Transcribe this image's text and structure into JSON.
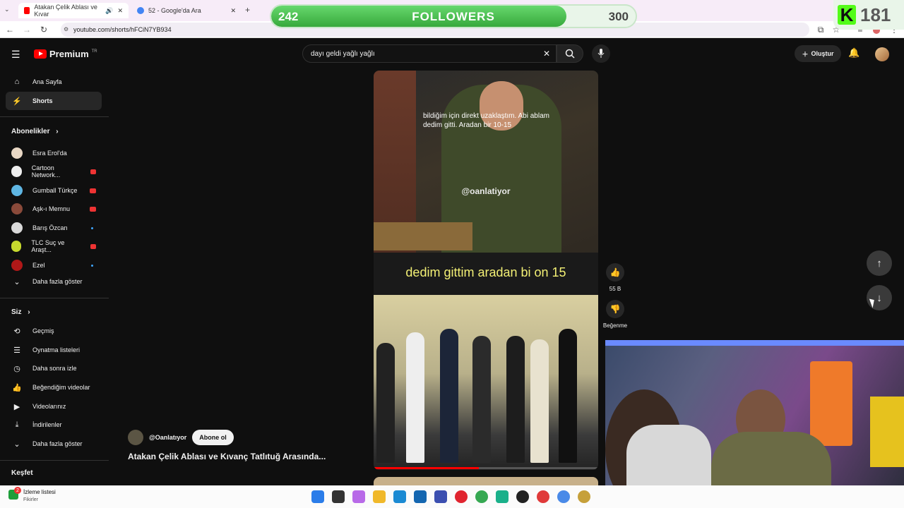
{
  "browser": {
    "tabs": [
      {
        "title": "Atakan Çelik Ablası ve Kıvar",
        "active": true
      },
      {
        "title": "52 - Google'da Ara",
        "active": false
      }
    ],
    "new_tab": "+",
    "url": "youtube.com/shorts/hFCiN7YB934"
  },
  "overlay": {
    "followers_current": "242",
    "followers_label": "FOLLOWERS",
    "followers_goal": "300",
    "followers_progress": 0.81,
    "kick_logo": "K",
    "kick_count": "181"
  },
  "header": {
    "logo_text": "Premium",
    "logo_region": "TR",
    "search_query": "dayı geldi yağlı yağlı",
    "create_label": "Oluştur"
  },
  "sidebar": {
    "main": [
      {
        "label": "Ana Sayfa",
        "icon": "home-icon",
        "selected": false
      },
      {
        "label": "Shorts",
        "icon": "shorts-icon",
        "selected": true
      }
    ],
    "subscriptions_title": "Abonelikler",
    "subscriptions": [
      {
        "label": "Esra Erol'da",
        "indicator": "none",
        "color": "#e8d7c4"
      },
      {
        "label": "Cartoon Network...",
        "indicator": "live",
        "color": "#eeeeee"
      },
      {
        "label": "Gumball Türkçe",
        "indicator": "live",
        "color": "#5fb6e3"
      },
      {
        "label": "Aşk-ı Memnu",
        "indicator": "live",
        "color": "#8a4a3a"
      },
      {
        "label": "Barış Özcan",
        "indicator": "dot",
        "color": "#d9d9d9"
      },
      {
        "label": "TLC Suç ve Araşt...",
        "indicator": "live",
        "color": "#c7d92e"
      },
      {
        "label": "Ezel",
        "indicator": "dot",
        "color": "#b01818"
      }
    ],
    "show_more": "Daha fazla göster",
    "you_title": "Siz",
    "you": [
      {
        "label": "Geçmiş",
        "icon": "history-icon"
      },
      {
        "label": "Oynatma listeleri",
        "icon": "playlist-icon"
      },
      {
        "label": "Daha sonra izle",
        "icon": "clock-icon"
      },
      {
        "label": "Beğendiğim videolar",
        "icon": "thumbs-up-icon"
      },
      {
        "label": "Videolarınız",
        "icon": "video-icon"
      },
      {
        "label": "İndirilenler",
        "icon": "download-icon"
      }
    ],
    "you_show_more": "Daha fazla göster",
    "explore_title": "Keşfet"
  },
  "short": {
    "caption_top": "bildiğim için direkt uzaklaştım. Abi ablam dedim gitti. Aradan bir 10-15",
    "watermark": "@oanlatiyor",
    "subtitle": "dedim gittim aradan bi on 15",
    "progress": 0.47,
    "channel": "@Oanlatıyor",
    "subscribe": "Abone ol",
    "title": "Atakan Çelik Ablası ve Kıvanç Tatlıtuğ Arasında...",
    "likes": "55 B",
    "dislike_label": "Beğenme"
  },
  "taskbar": {
    "watchlist_title": "İzleme listesi",
    "watchlist_sub": "Fikirler",
    "badge": "2"
  }
}
